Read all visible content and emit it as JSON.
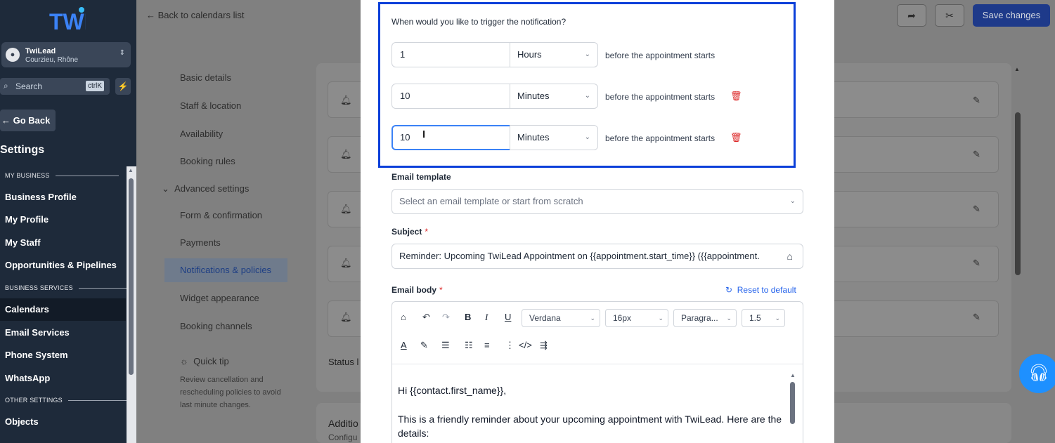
{
  "sidebar": {
    "logo": "TWI",
    "account": {
      "name": "TwiLead",
      "location": "Courzieu, Rhône"
    },
    "search": {
      "placeholder": "Search",
      "shortcut": "ctrlK"
    },
    "go_back": "Go Back",
    "title": "Settings",
    "sections": {
      "my_business": "MY BUSINESS",
      "business_services": "BUSINESS SERVICES",
      "other_settings": "OTHER SETTINGS"
    },
    "items": {
      "business_profile": "Business Profile",
      "my_profile": "My Profile",
      "my_staff": "My Staff",
      "opportunities": "Opportunities & Pipelines",
      "calendars": "Calendars",
      "email_services": "Email Services",
      "phone_system": "Phone System",
      "whatsapp": "WhatsApp",
      "objects": "Objects"
    }
  },
  "topbar": {
    "back_link": "Back to calendars list",
    "save_label": "Save changes"
  },
  "settings_menu": {
    "basic_details": "Basic details",
    "staff_location": "Staff & location",
    "availability": "Availability",
    "booking_rules": "Booking rules",
    "advanced_settings": "Advanced settings",
    "form_confirmation": "Form & confirmation",
    "payments": "Payments",
    "notifications": "Notifications & policies",
    "widget_appearance": "Widget appearance",
    "booking_channels": "Booking channels",
    "quick_tip_title": "Quick tip",
    "quick_tip_body": "Review cancellation and rescheduling policies to avoid last minute changes."
  },
  "background_card": {
    "status_label": "Status l",
    "additional_title": "Additio",
    "configure": "Configu"
  },
  "modal": {
    "trigger_question": "When would you like to trigger the notification?",
    "triggers": [
      {
        "value": "1",
        "unit": "Hours",
        "suffix": "before the appointment starts"
      },
      {
        "value": "10",
        "unit": "Minutes",
        "suffix": "before the appointment starts"
      },
      {
        "value": "10",
        "unit": "Minutes",
        "suffix": "before the appointment starts"
      }
    ],
    "email_template": {
      "label": "Email template",
      "placeholder": "Select an email template or start from scratch"
    },
    "subject": {
      "label": "Subject",
      "required_mark": "*",
      "value": "Reminder: Upcoming TwiLead Appointment on {{appointment.start_time}} ({{appointment."
    },
    "email_body": {
      "label": "Email body",
      "required_mark": "*",
      "reset_label": "Reset to default",
      "toolbar": {
        "font": "Verdana",
        "size": "16px",
        "block": "Paragra...",
        "line_height": "1.5"
      },
      "lines": [
        "Hi {{contact.first_name}},",
        " This is a friendly reminder about your upcoming appointment with TwiLead. Here are the details:"
      ]
    }
  },
  "colors": {
    "accent": "#2563eb",
    "highlight_border": "#0b3fd9",
    "danger": "#dc2626",
    "sidebar_bg": "#1e2a3a"
  }
}
